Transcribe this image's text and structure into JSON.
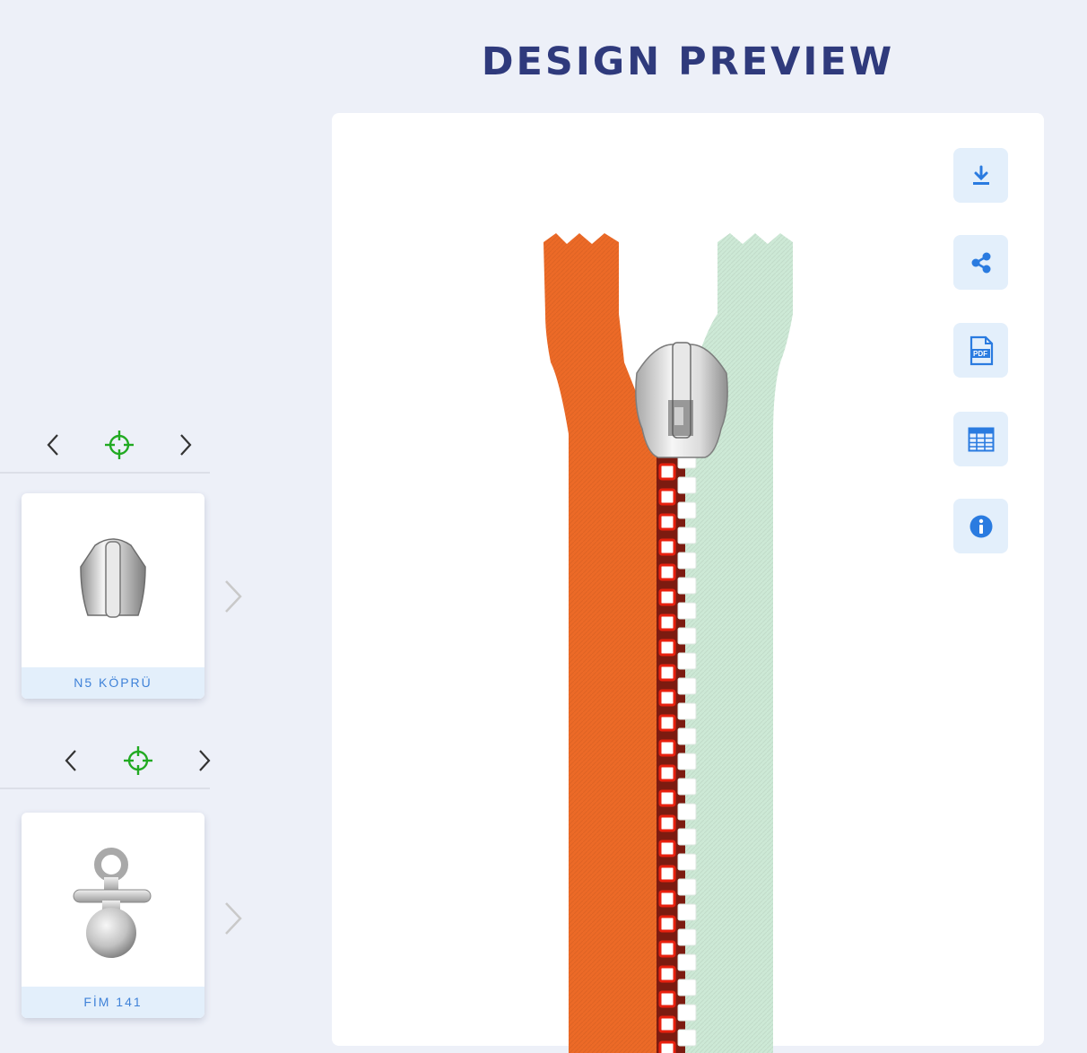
{
  "header": {
    "title": "DESIGN PREVIEW"
  },
  "colors": {
    "title": "#2f3a7c",
    "accent_blue": "#2a7be0",
    "target_green": "#22aa22",
    "tape_left": "#ec6a27",
    "tape_right": "#cde9d6",
    "teeth_left": "#e8200e",
    "teeth_right": "#ffffff"
  },
  "sidebar": {
    "components": [
      {
        "name": "N5 KÖPRÜ",
        "icon": "slider-bridge-icon"
      },
      {
        "name": "FİM 141",
        "icon": "pacifier-puller-icon"
      }
    ]
  },
  "toolbar": {
    "buttons": [
      {
        "icon": "download-icon"
      },
      {
        "icon": "share-icon"
      },
      {
        "icon": "pdf-icon",
        "text": "PDF"
      },
      {
        "icon": "table-icon"
      },
      {
        "icon": "info-icon"
      }
    ]
  }
}
